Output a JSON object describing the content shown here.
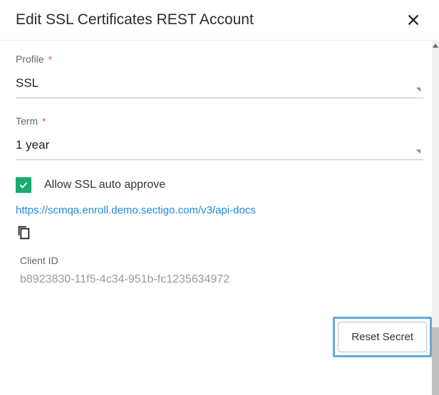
{
  "header": {
    "title": "Edit SSL Certificates REST Account"
  },
  "fields": {
    "profile": {
      "label": "Profile",
      "value": "SSL",
      "required": "*"
    },
    "term": {
      "label": "Term",
      "value": "1 year",
      "required": "*"
    }
  },
  "checkbox": {
    "label": "Allow SSL auto approve"
  },
  "api_docs_url": "https://scmqa.enroll.demo.sectigo.com/v3/api-docs",
  "client_id": {
    "label": "Client ID",
    "value": "b8923830-11f5-4c34-951b-fc1235634972"
  },
  "actions": {
    "reset_secret": "Reset Secret"
  }
}
